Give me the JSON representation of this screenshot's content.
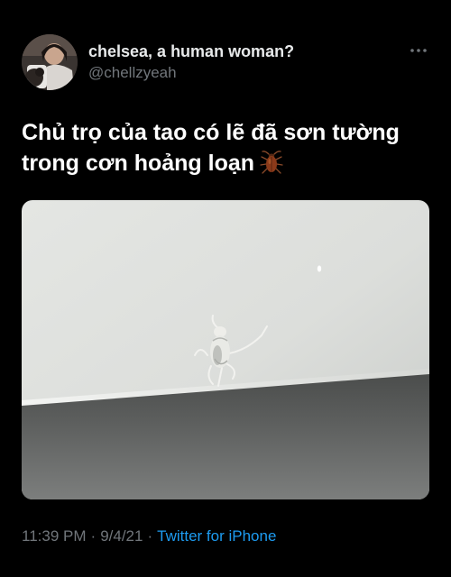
{
  "author": {
    "display_name": "chelsea, a human woman?",
    "handle": "@chellzyeah",
    "avatar_icon": "profile-photo"
  },
  "menu": {
    "icon": "more-horizontal-icon"
  },
  "tweet": {
    "lines": [
      "Chủ trọ của tao có lẽ đã sơn tường",
      "trong cơn hoảng loạn"
    ],
    "emoji_icon": "cockroach-emoji-icon"
  },
  "media": {
    "type": "photo"
  },
  "meta": {
    "time": "11:39 PM",
    "separator": "·",
    "date": "9/4/21",
    "source": "Twitter for iPhone"
  },
  "colors": {
    "background": "#000000",
    "text_primary": "#e7e9ea",
    "text_secondary": "#71767b",
    "link": "#1d9bf0"
  }
}
